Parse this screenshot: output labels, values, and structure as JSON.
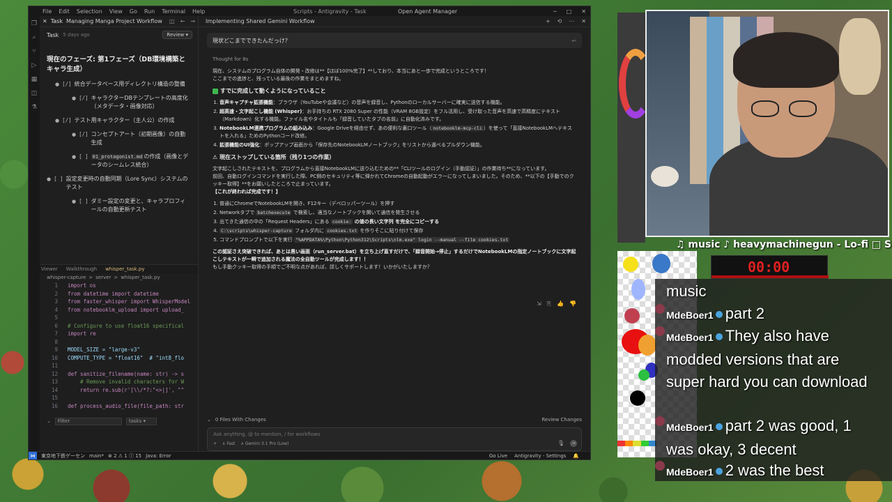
{
  "ide": {
    "menu": [
      "File",
      "Edit",
      "Selection",
      "View",
      "Go",
      "Run",
      "Terminal",
      "Help"
    ],
    "center_title": "Scripts - Antigravity - Task",
    "agent_manager": "Open Agent Manager",
    "task_tab": {
      "label": "Task",
      "title": "Managing Manga Project Workflow"
    },
    "task_meta": {
      "label": "Task",
      "ago": "5 days ago",
      "review": "Review"
    },
    "phase_title": "現在のフェーズ: 第1フェーズ（DB環境構築とキャラ生成）",
    "tasks": [
      {
        "level": 1,
        "check": "[/]",
        "text": "統合データベース用ディレクトリ構造の整備"
      },
      {
        "level": 2,
        "check": "[/]",
        "text": "キャラクターDBテンプレートの高度化（メタデータ・画像対応）"
      },
      {
        "level": 1,
        "check": "[/]",
        "text": "テスト用キャラクター（主人公）の作成"
      },
      {
        "level": 2,
        "check": "[/]",
        "text": "コンセプトアート（初期画像）の自動生成"
      },
      {
        "level": 2,
        "check": "[ ]",
        "code": "01_protagonist.md",
        "text": "の作成（画像とデータのシームレス統合）"
      },
      {
        "level": 0,
        "check": "[ ]",
        "text": "設定変更時の自動同期（Lore Sync）システムのテスト"
      },
      {
        "level": 2,
        "check": "[ ]",
        "text": "ダミー設定の変更と、キャラプロフィールの自動更新テスト"
      }
    ],
    "lower_tabs": [
      "Viewer",
      "Walkthrough",
      "whisper_task.py"
    ],
    "breadcrumb": [
      "whisper-capture",
      ">",
      "server",
      ">",
      "whisper_task.py"
    ],
    "code_lines": [
      {
        "n": "1",
        "t": "import os"
      },
      {
        "n": "2",
        "t": "from datetime import datetime"
      },
      {
        "n": "3",
        "t": "from faster_whisper import WhisperModel"
      },
      {
        "n": "4",
        "t": "from notebooklm_upload import upload_"
      },
      {
        "n": "5",
        "t": ""
      },
      {
        "n": "6",
        "t": "# Configure to use float16 specifical"
      },
      {
        "n": "7",
        "t": "import re"
      },
      {
        "n": "8",
        "t": ""
      },
      {
        "n": "9",
        "t": "MODEL_SIZE = \"large-v3\""
      },
      {
        "n": "10",
        "t": "COMPUTE_TYPE = \"float16\"  # \"int8_flo"
      },
      {
        "n": "11",
        "t": ""
      },
      {
        "n": "12",
        "t": "def sanitize_filename(name: str) -> s"
      },
      {
        "n": "13",
        "t": "    # Remove invalid characters for W"
      },
      {
        "n": "14",
        "t": "    return re.sub(r'[\\\\/*?:\"<>|]', \"\""
      },
      {
        "n": "15",
        "t": ""
      },
      {
        "n": "16",
        "t": "def process_audio_file(file_path: str"
      }
    ],
    "filter": {
      "placeholder": "Filter",
      "tasks": "tasks"
    },
    "chat": {
      "title": "Implementing Shared Gemini Workflow",
      "user_msg": "現状どこまでできたんだっけ？",
      "thought": "Thought for 8s",
      "intro1": "現在、システムのプログラム自体の開発・改修は**【ほぼ100%完了】**しており、本当にあと一歩で完成というところです！",
      "intro2": "ここまでの進捗と、残っている最後の作業をまとめますね。",
      "done_heading": "すでに完成して動くようになっていること",
      "done_items": [
        {
          "b": "音声キャプチャ拡張機能",
          "t": "：ブラウザ（YouTubeや会議など）の音声を録音し、Pythonのローカルサーバーに確実に送信する機能。"
        },
        {
          "b": "超高速・文字起こし機能 (Whisper)",
          "t": "：お手持ちの RTX 2080 Super の性能（VRAM 8GB設定）をフル活用し、受け取った音声を高速で高精度にテキスト（Markdown）化する機能。ファイル名やタイトルも「録音していたタブの名前」に自動化済みです。"
        },
        {
          "b": "NotebookLM連携プログラムの組み込み",
          "t": "：Google Driveを経由せず、あの便利な裏口ツール（",
          "code": "notebooklm-mcp-cli",
          "t2": "）を使って「直接NotebookLMへテキストを入れる」ためのPythonコード改修。"
        },
        {
          "b": "拡張機能のUI強化",
          "t": "：ポップアップ画面から「保存先のNotebookLMノートブック」をリストから選べるプルダウン機能。"
        }
      ],
      "stop_heading": "現在ストップしている箇所（残り1つの作業）",
      "stop_p1": "文字起こしされたテキストを、プログラムから直接NotebookLMに送り込むための**「CLIツールのログイン（手動認証）」の作業待ち**になっています。",
      "stop_p2": "前回、自動ログインコマンドを実行した際、PC側のセキュリティ等に弾かれてChromeの自動起動がエラーになってしまいました。そのため、**以下の【手動でのクッキー取得】**をお願いしたところで止まっています。",
      "finish": "【これが終われば完成です！】",
      "steps": [
        {
          "t": "普通にChromeでNotebookLMを開き、F12キー（デベロッパーツール）を押す"
        },
        {
          "t": "Networkタブで ",
          "code": "batchexecute",
          "t2": " で検索し、適当なノートブックを開いて通信を発生させる"
        },
        {
          "t": "出てきた通信の中の「Request Headers」にある ",
          "code": "cookie:",
          "t2": " の値の長い文字列 を完全にコピーする"
        },
        {
          "t": "",
          "code": "C:\\scripts\\whisper-capture",
          "t2": " フォルダ内に ",
          "code2": "cookies.txt",
          "t3": " を作りそこに貼り付けて保存"
        },
        {
          "t": "コマンドプロンプトで以下を実行 ",
          "code": "\"%APPDATA%\\Python\\Python312\\Scripts\\nlm.exe\" login --manual --file cookies.txt",
          "t2": ""
        }
      ],
      "closing1": "この認証さえ突破できれば、あとは黒い画面（run_server.bat）を立ち上げ直すだけで、「録音開始→停止」するだけでNotebookLMの指定ノートブックに文字起こしテキストが一瞬で追加される魔法の全自動ツールが完成します！！",
      "closing2": "もし手動クッキー取得の手順でご不明な点があれば、詳しくサポートします！いかがいたしますか？",
      "files_changed": "0 Files With Changes",
      "review_changes": "Review Changes",
      "input_placeholder": "Ask anything, @ to mention, / for workflows",
      "mode": "Fast",
      "model": "Gemini 3.1 Pro (Low)"
    },
    "status": {
      "branch": "東京地下鉄ゲーセン",
      "main": "main*",
      "problems": "⊗ 2 ⚠ 1 ⓘ 15",
      "java": "Java: Error",
      "golive": "Go Live",
      "settings": "Antigravity - Settings"
    }
  },
  "stream": {
    "now_playing": "♫ music ♪ heavymachinegun - Lo-fi □ S",
    "timer": "00:00",
    "chat": [
      {
        "user": "",
        "text": "music"
      },
      {
        "user": "MdeBoer1",
        "text": "part 2"
      },
      {
        "user": "MdeBoer1",
        "text": "They also have modded versions that are super hard you can download"
      },
      {
        "user": "MdeBoer1",
        "text": "part 2 was good, 1 was okay, 3 decent"
      },
      {
        "user": "MdeBoer1",
        "text": "2 was the best"
      }
    ]
  }
}
